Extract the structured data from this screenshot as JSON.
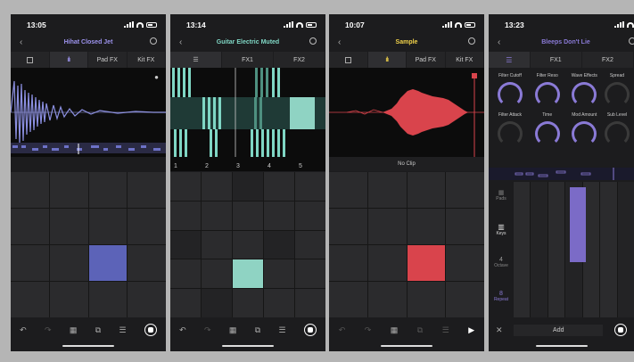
{
  "phones": [
    {
      "time": "13:05",
      "title": "Hihat Closed Jet",
      "title_color": "#9d93ee",
      "tabs": [
        "",
        "",
        "Pad FX",
        "Kit FX"
      ],
      "accent": "#6b72c7"
    },
    {
      "time": "13:14",
      "title": "Guitar Electric Muted",
      "title_color": "#7fd6c4",
      "tabs": [
        "",
        "FX1",
        "FX2"
      ],
      "beat_numbers": [
        "1",
        "2",
        "3",
        "4",
        "5"
      ],
      "accent": "#8fd3c3"
    },
    {
      "time": "10:07",
      "title": "Sample",
      "title_color": "#f1d24a",
      "tabs": [
        "",
        "",
        "Pad FX",
        "Kit FX"
      ],
      "footer_text": "No Clip",
      "accent": "#d9444c"
    },
    {
      "time": "13:23",
      "title": "Bleeps Don't Lie",
      "title_color": "#8a7ad6",
      "tabs": [
        "",
        "FX1",
        "FX2"
      ],
      "params_row1": [
        "Filter Cutoff",
        "Filter Reso",
        "Wave Effects",
        "Spread"
      ],
      "params_row2": [
        "Filter Attack",
        "Time",
        "Mod Amount",
        "Sub Level"
      ],
      "side_labels": [
        "Pads",
        "Keys",
        "Octave",
        "Repeat"
      ],
      "octave_value": "4",
      "repeat_value": "8",
      "add_label": "Add",
      "accent": "#7b6bc7"
    }
  ]
}
